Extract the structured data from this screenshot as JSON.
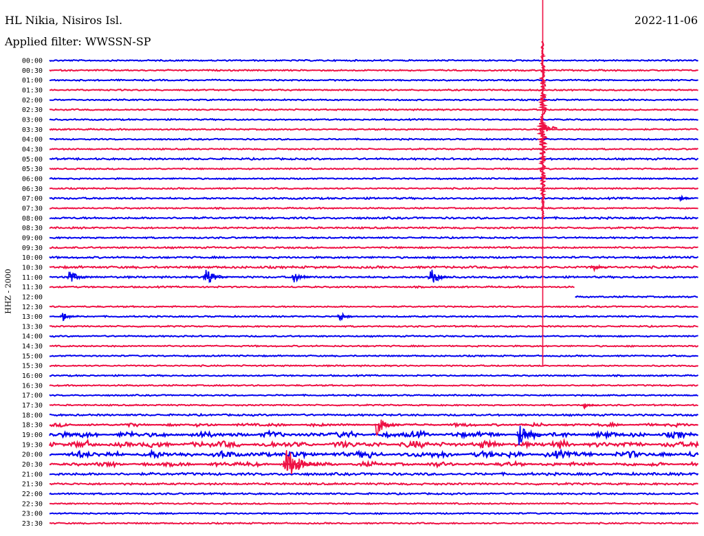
{
  "header": {
    "station": "HL Nikia, Nisiros Isl.",
    "filter": "Applied filter: WWSSN-SP",
    "date": "2022-11-06"
  },
  "chart_data": {
    "type": "line",
    "title": "HL Nikia, Nisiros Isl.",
    "subtitle": "Applied filter: WWSSN-SP",
    "date": "2022-11-06",
    "ylabel": "HHZ - 2000",
    "row_labels": [
      "00:00",
      "00:30",
      "01:00",
      "01:30",
      "02:00",
      "02:30",
      "03:00",
      "03:30",
      "04:00",
      "04:30",
      "05:00",
      "05:30",
      "06:00",
      "06:30",
      "07:00",
      "07:30",
      "08:00",
      "08:30",
      "09:00",
      "09:30",
      "10:00",
      "10:30",
      "11:00",
      "11:30",
      "12:00",
      "12:30",
      "13:00",
      "13:30",
      "14:00",
      "14:30",
      "15:00",
      "15:30",
      "16:00",
      "16:30",
      "17:00",
      "17:30",
      "18:00",
      "18:30",
      "19:00",
      "19:30",
      "20:00",
      "20:30",
      "21:00",
      "21:30",
      "22:00",
      "22:30",
      "23:00",
      "23:30"
    ],
    "row_minutes": 30,
    "colors": {
      "even_rows": "#0000ee",
      "odd_rows": "#ee1144"
    },
    "data_gap": {
      "start": "11:30 +24.3min",
      "end": "12:00 +24.3min"
    },
    "noise_level_by_row": [
      1,
      1,
      1,
      1,
      1,
      1,
      1,
      1,
      1,
      1,
      1.3,
      1,
      1,
      1,
      1.3,
      1,
      1.4,
      1.2,
      1.1,
      1.2,
      1.3,
      1.6,
      1.3,
      1.1,
      1.1,
      1,
      1,
      1,
      1,
      1,
      1,
      1,
      1,
      1,
      1,
      1,
      1.3,
      2.2,
      4,
      4.5,
      4.6,
      3,
      1.8,
      1.4,
      1.2,
      1,
      1,
      1
    ],
    "events": [
      {
        "label": "large earthquake",
        "row": "00:00",
        "minute": 22.8,
        "amplitude": 1.0
      },
      {
        "label": "event",
        "row": "11:00",
        "minute": 0.9,
        "amplitude": 0.03
      },
      {
        "label": "event",
        "row": "11:00",
        "minute": 7.2,
        "amplitude": 0.04
      },
      {
        "label": "event",
        "row": "11:00",
        "minute": 11.3,
        "amplitude": 0.025
      },
      {
        "label": "event",
        "row": "11:00",
        "minute": 17.6,
        "amplitude": 0.035
      },
      {
        "label": "event",
        "row": "13:00",
        "minute": 0.6,
        "amplitude": 0.02
      },
      {
        "label": "event",
        "row": "13:00",
        "minute": 13.4,
        "amplitude": 0.02
      },
      {
        "label": "event",
        "row": "10:30",
        "minute": 25.1,
        "amplitude": 0.02
      },
      {
        "label": "event",
        "row": "07:00",
        "minute": 29.1,
        "amplitude": 0.015
      },
      {
        "label": "event",
        "row": "18:30",
        "minute": 15.1,
        "amplitude": 0.04
      },
      {
        "label": "event",
        "row": "19:00",
        "minute": 21.7,
        "amplitude": 0.04
      },
      {
        "label": "event",
        "row": "20:30",
        "minute": 10.9,
        "amplitude": 0.07
      },
      {
        "label": "event",
        "row": "17:30",
        "minute": 24.7,
        "amplitude": 0.015
      }
    ]
  }
}
